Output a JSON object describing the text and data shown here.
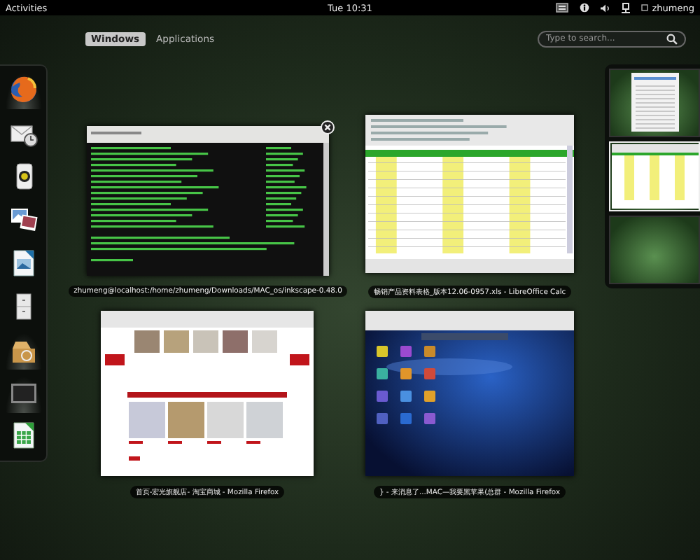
{
  "top_bar": {
    "activities": "Activities",
    "clock": "Tue 10:31",
    "user": "zhumeng"
  },
  "view_tabs": [
    {
      "label": "Windows",
      "selected": true
    },
    {
      "label": "Applications",
      "selected": false
    }
  ],
  "search": {
    "placeholder": "Type to search..."
  },
  "dash": [
    {
      "kind": "firefox",
      "running": true
    },
    {
      "kind": "mail",
      "running": false
    },
    {
      "kind": "speaker",
      "running": false
    },
    {
      "kind": "photos",
      "running": false
    },
    {
      "kind": "impress",
      "running": false
    },
    {
      "kind": "cabinet",
      "running": false
    },
    {
      "kind": "archive",
      "running": true
    },
    {
      "kind": "terminal",
      "running": true
    },
    {
      "kind": "calc",
      "running": false
    }
  ],
  "windows": [
    {
      "kind": "terminal",
      "caption": "zhumeng@localhost:/home/zhumeng/Downloads/MAC_os/inkscape-0.48.0",
      "hovered": true
    },
    {
      "kind": "spreadsheet",
      "caption": "畅销产品资料表格_版本12.06-0957.xls - LibreOffice Calc",
      "hovered": false
    },
    {
      "kind": "shop",
      "caption": "首页-宏光旗舰店- 淘宝商城 - Mozilla Firefox",
      "hovered": false
    },
    {
      "kind": "desktop",
      "caption": "} - 来消息了...MAC—我要黑苹果(总群 - Mozilla Firefox",
      "hovered": false
    }
  ],
  "workspaces": [
    {
      "kind": "document",
      "selected": false
    },
    {
      "kind": "spreadsheet",
      "selected": true
    },
    {
      "kind": "empty",
      "selected": false
    }
  ]
}
